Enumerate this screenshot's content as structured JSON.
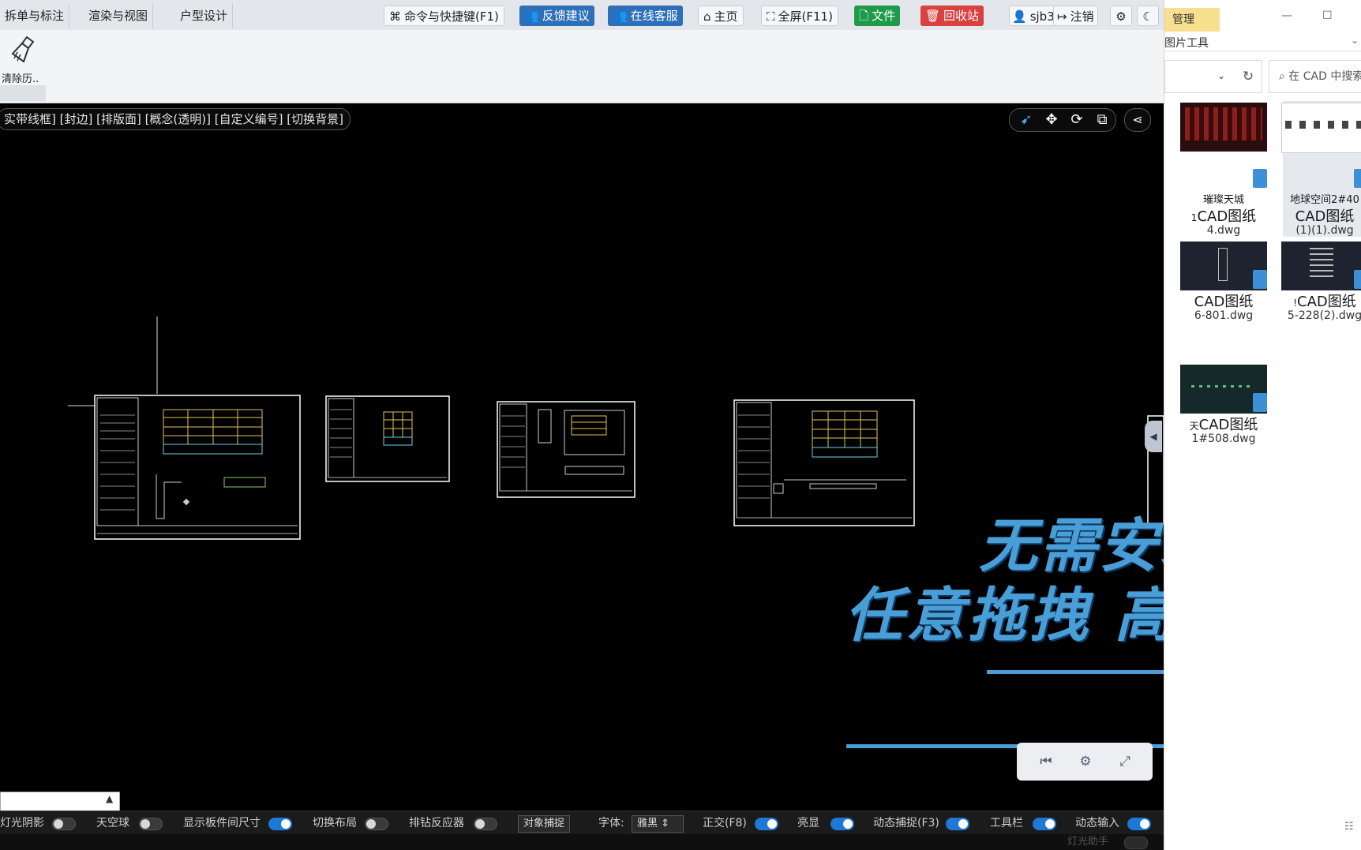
{
  "topbar": {
    "tabs": [
      "拆单与标注",
      "渲染与视图",
      "户型设计"
    ],
    "buttons": {
      "commands": "命令与快捷键(F1)",
      "feedback": "反馈建议",
      "support": "在线客服",
      "home": "主页",
      "fullscreen": "全屏(F11)",
      "file": "文件",
      "recycle": "回收站",
      "user": "sjb3",
      "logout": "注销"
    },
    "icons": {
      "commands": "command-icon",
      "feedback": "users-icon",
      "support": "users-icon",
      "home": "home-icon",
      "fullscreen": "fullscreen-icon",
      "file": "file-icon",
      "recycle": "trash-icon",
      "user": "user-icon",
      "logout": "logout-icon",
      "settings": "gear-icon",
      "theme": "moon-icon"
    },
    "colors": {
      "blue": "#2d6fb8",
      "green": "#1f9a4a",
      "red": "#d94040"
    }
  },
  "ribbon": {
    "clear_history": "清除历.."
  },
  "viewport": {
    "modes_text": "实带线框]  [封边]  [排版面]  [概念(透明)]  [自定义编号]  [切换背景]"
  },
  "overlay": {
    "line1": "无需安装CAD",
    "line2": "任意拖拽  高效看图",
    "color": "#4a9ed8"
  },
  "statusbar": {
    "items": [
      {
        "label": "灯光阴影",
        "on": false
      },
      {
        "label": "天空球",
        "on": false
      },
      {
        "label": "显示板件间尺寸",
        "on": true
      },
      {
        "label": "切换布局",
        "on": false
      },
      {
        "label": "排钻反应器",
        "on": false
      },
      {
        "label": "对象捕捉",
        "on": null
      },
      {
        "label": "字体:",
        "select": "雅黑"
      },
      {
        "label": "正交(F8)",
        "on": true
      },
      {
        "label": "亮显",
        "on": true
      },
      {
        "label": "动态捕捉(F3)",
        "on": true
      },
      {
        "label": "工具栏",
        "on": true
      },
      {
        "label": "动态输入",
        "on": true
      }
    ],
    "lamp_helper": "灯光助手"
  },
  "explorer": {
    "manage_tab": "管理",
    "picture_tools": "图片工具",
    "search_placeholder": "在 CAD 中搜索",
    "files": [
      {
        "line1": "璀璨天城",
        "line2": "CAD图纸",
        "line3": "4.dwg",
        "prefix": "1"
      },
      {
        "line1": "地球空间2#40",
        "line2": "CAD图纸",
        "line3": "(1)(1).dwg",
        "prefix": ""
      },
      {
        "line1": "",
        "line2": "CAD图纸",
        "line3": "6-801.dwg",
        "prefix": ""
      },
      {
        "line1": "",
        "line2": "CAD图纸",
        "line3": "5-228(2).dwg",
        "prefix": "!"
      },
      {
        "line1": "",
        "line2": "CAD图纸",
        "line3": "1#508.dwg",
        "prefix": "天"
      }
    ]
  }
}
